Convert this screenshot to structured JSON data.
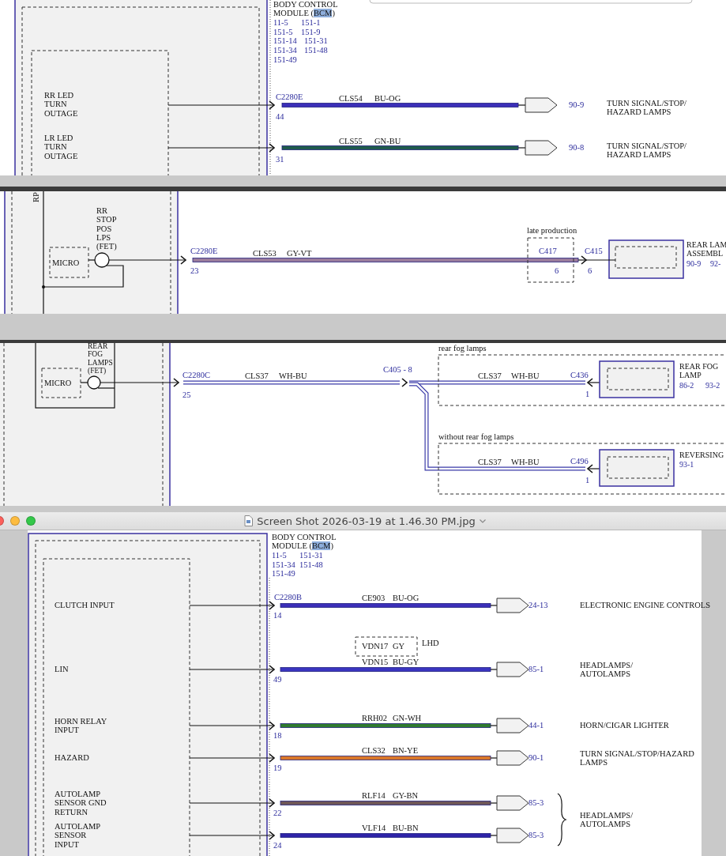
{
  "diagram_1": {
    "module": {
      "title": "BODY CONTROL",
      "name_line": {
        "before": "MODULE (",
        "highlighted": "BCM",
        "after": ")"
      },
      "refs": [
        [
          "11-5",
          "151-1"
        ],
        [
          "151-5",
          "151-9"
        ],
        [
          "151-14",
          "151-31"
        ],
        [
          "151-34",
          "151-48"
        ],
        [
          "151-49"
        ]
      ]
    },
    "rows": [
      {
        "label_lines": [
          "RR LED",
          "TURN",
          "OUTAGE"
        ],
        "connector": "C2280E",
        "pin": "44",
        "circuit": "CLS54",
        "wire_code": "BU-OG",
        "color": "#3b2fb8",
        "ref": "90-9",
        "destination_lines": [
          "TURN SIGNAL/STOP/",
          "HAZARD LAMPS"
        ]
      },
      {
        "label_lines": [
          "LR LED",
          "TURN",
          "OUTAGE"
        ],
        "pin": "31",
        "circuit": "CLS55",
        "wire_code": "GN-BU",
        "color": "#1f5a4c",
        "ref": "90-8",
        "destination_lines": [
          "TURN SIGNAL/STOP/",
          "HAZARD LAMPS"
        ]
      }
    ]
  },
  "diagram_2": {
    "side_label": "RP",
    "micro": "MICRO",
    "output_label_lines": [
      "RR",
      "STOP",
      "POS",
      "LPS",
      "(FET)"
    ],
    "connector": "C2280E",
    "pin": "23",
    "circuit": "CLS53",
    "wire_code": "GY-VT",
    "color": "#9a7c9c",
    "inline_note": "late production",
    "inline_connector": "C417",
    "inline_pin": "6",
    "end_connector": "C415",
    "end_pin": "6",
    "component_lines": [
      "REAR LAM",
      "ASSEMBL"
    ],
    "component_refs": [
      "90-9",
      "92-"
    ]
  },
  "diagram_3": {
    "micro": "MICRO",
    "output_label_lines": [
      "REAR",
      "FOG",
      "LAMPS",
      "(FET)"
    ],
    "connector": "C2280C",
    "pin": "25",
    "circuit": "CLS37",
    "wire_code": "WH-BU",
    "splice_label": "C405 - 8",
    "branches": [
      {
        "note": "rear fog lamps",
        "circuit": "CLS37",
        "wire_code": "WH-BU",
        "connector": "C436",
        "pin": "1",
        "component_lines": [
          "REAR FOG",
          "LAMP"
        ],
        "component_refs": [
          "86-2",
          "93-2"
        ]
      },
      {
        "note": "without rear fog lamps",
        "circuit": "CLS37",
        "wire_code": "WH-BU",
        "connector": "C496",
        "pin": "1",
        "component_lines": [
          "REVERSING"
        ],
        "component_refs": [
          "93-1"
        ]
      }
    ]
  },
  "viewer_window": {
    "title": "Screen Shot 2026-03-19 at 1.46.30 PM.jpg",
    "module": {
      "title": "BODY CONTROL",
      "name_line": {
        "before": "MODULE (",
        "highlighted": "BCM",
        "after": ")"
      },
      "refs": [
        [
          "11-5",
          "151-31"
        ],
        [
          "151-34",
          "151-48"
        ],
        [
          "151-49"
        ]
      ]
    },
    "rows": [
      {
        "label_lines": [
          "CLUTCH INPUT"
        ],
        "connector": "C2280B",
        "pin": "14",
        "circuit": "CE903",
        "wire_code": "BU-OG",
        "color": "#3b2fb8",
        "ref": "24-13",
        "destination_lines": [
          "ELECTRONIC ENGINE CONTROLS"
        ]
      },
      {
        "label_lines": [
          "LIN"
        ],
        "pin": "49",
        "alt_circuit": {
          "circuit": "VDN17",
          "wire_code": "GY",
          "note": "LHD"
        },
        "circuit": "VDN15",
        "wire_code": "BU-GY",
        "color": "#3a35c0",
        "ref": "85-1",
        "destination_lines": [
          "HEADLAMPS/",
          "AUTOLAMPS"
        ]
      },
      {
        "label_lines": [
          "HORN RELAY",
          "INPUT"
        ],
        "pin": "18",
        "circuit": "RRH02",
        "wire_code": "GN-WH",
        "color": "#2f7a2f",
        "ref": "44-1",
        "destination_lines": [
          "HORN/CIGAR LIGHTER"
        ]
      },
      {
        "label_lines": [
          "HAZARD"
        ],
        "pin": "19",
        "circuit": "CLS32",
        "wire_code": "BN-YE",
        "color": "#d9772a",
        "ref": "90-1",
        "destination_lines": [
          "TURN SIGNAL/STOP/HAZARD",
          "LAMPS"
        ]
      },
      {
        "label_lines": [
          "AUTOLAMP",
          "SENSOR GND",
          "RETURN"
        ],
        "pin": "22",
        "circuit": "RLF14",
        "wire_code": "GY-BN",
        "color": "#6e5757",
        "ref": "85-3"
      },
      {
        "label_lines": [
          "AUTOLAMP",
          "SENSOR",
          "INPUT"
        ],
        "pin": "24",
        "circuit": "VLF14",
        "wire_code": "BU-BN",
        "color": "#2e24a8",
        "ref": "85-3"
      }
    ],
    "grouped_destination_lines": [
      "HEADLAMPS/",
      "AUTOLAMPS"
    ]
  }
}
